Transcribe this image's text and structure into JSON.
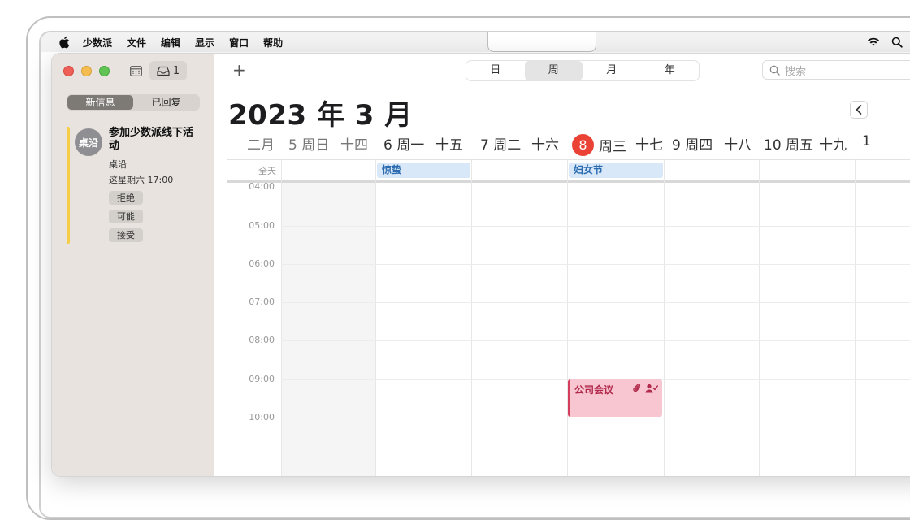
{
  "menubar": {
    "app_name": "少数派",
    "items": [
      "文件",
      "编辑",
      "显示",
      "窗口",
      "帮助"
    ]
  },
  "toolbar": {
    "inbox_count": "1",
    "add_label": "+",
    "views": [
      "日",
      "周",
      "月",
      "年"
    ],
    "active_view": "周",
    "search_placeholder": "搜索"
  },
  "sidebar": {
    "tabs": [
      "新信息",
      "已回复"
    ],
    "active_tab": "新信息",
    "invite": {
      "avatar_text": "桌沿",
      "title": "参加少数派线下活动",
      "organizer": "桌沿",
      "when": "这星期六 17:00",
      "responses": [
        "拒绝",
        "可能",
        "接受"
      ]
    }
  },
  "calendar": {
    "month_title": "2023 年 3 月",
    "days": [
      {
        "label": "二月",
        "weekend": true
      },
      {
        "label": "5 周日",
        "weekend": true
      },
      {
        "label": "十四",
        "weekend": true
      },
      {
        "label": "6 周一",
        "weekend": false
      },
      {
        "label": "十五",
        "weekend": false
      },
      {
        "label": "7 周二",
        "weekend": false
      },
      {
        "label": "十六",
        "weekend": false
      },
      {
        "today_number": "8",
        "label": "周三",
        "weekend": false
      },
      {
        "label": "十七",
        "weekend": false
      },
      {
        "label": "9 周四",
        "weekend": false
      },
      {
        "label": "十八",
        "weekend": false
      },
      {
        "label": "10 周五",
        "weekend": false
      },
      {
        "label": "十九",
        "weekend": false
      },
      {
        "label": "1",
        "weekend": false
      }
    ],
    "allday_label": "全天",
    "allday_events": [
      {
        "title": "惊蛰",
        "column": 1
      },
      {
        "title": "妇女节",
        "column": 3
      }
    ],
    "hours": [
      "04:00",
      "05:00",
      "06:00",
      "07:00",
      "08:00",
      "09:00",
      "10:00"
    ],
    "events": [
      {
        "title": "公司会议",
        "column": 3,
        "start": "09:00",
        "has_attachment": true,
        "has_invitees": true
      }
    ]
  },
  "colors": {
    "today": "#ea4335",
    "invite_bar": "#f5cd47",
    "holiday_event_bg": "#d8e8f8",
    "meeting_event_bg": "#f7c6d1"
  }
}
